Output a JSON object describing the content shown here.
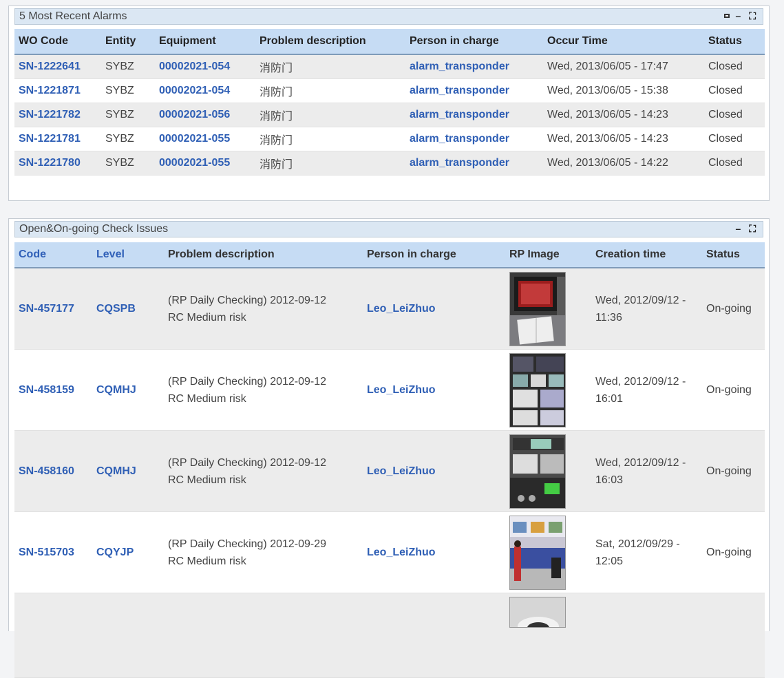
{
  "alarms": {
    "title": "5 Most Recent Alarms",
    "tools": [
      "settings-icon",
      "minimize-icon",
      "maximize-icon"
    ],
    "columns": [
      "WO Code",
      "Entity",
      "Equipment",
      "Problem description",
      "Person in charge",
      "Occur Time",
      "Status"
    ],
    "rows": [
      {
        "code": "SN-1222641",
        "entity": "SYBZ",
        "equipment": "00002021-054",
        "problem": "消防门",
        "person": "alarm_transponder",
        "time": "Wed, 2013/06/05 - 17:47",
        "status": "Closed"
      },
      {
        "code": "SN-1221871",
        "entity": "SYBZ",
        "equipment": "00002021-054",
        "problem": "消防门",
        "person": "alarm_transponder",
        "time": "Wed, 2013/06/05 - 15:38",
        "status": "Closed"
      },
      {
        "code": "SN-1221782",
        "entity": "SYBZ",
        "equipment": "00002021-056",
        "problem": "消防门",
        "person": "alarm_transponder",
        "time": "Wed, 2013/06/05 - 14:23",
        "status": "Closed"
      },
      {
        "code": "SN-1221781",
        "entity": "SYBZ",
        "equipment": "00002021-055",
        "problem": "消防门",
        "person": "alarm_transponder",
        "time": "Wed, 2013/06/05 - 14:23",
        "status": "Closed"
      },
      {
        "code": "SN-1221780",
        "entity": "SYBZ",
        "equipment": "00002021-055",
        "problem": "消防门",
        "person": "alarm_transponder",
        "time": "Wed, 2013/06/05 - 14:22",
        "status": "Closed"
      }
    ]
  },
  "issues": {
    "title": "Open&On-going Check Issues",
    "tools": [
      "minimize-icon",
      "maximize-icon"
    ],
    "columns": [
      "Code",
      "Level",
      "Problem description",
      "Person in charge",
      "RP Image",
      "Creation time",
      "Status"
    ],
    "rows": [
      {
        "code": "SN-457177",
        "level": "CQSPB",
        "problem_line1": "(RP Daily Checking) 2012-09-12",
        "problem_line2": "RC Medium risk",
        "person": "Leo_LeiZhuo",
        "image": "control-room-monitor-photo",
        "time_line1": "Wed, 2012/09/12 -",
        "time_line2": "11:36",
        "status": "On-going"
      },
      {
        "code": "SN-458159",
        "level": "CQMHJ",
        "problem_line1": "(RP Daily Checking) 2012-09-12",
        "problem_line2": "RC Medium risk",
        "person": "Leo_LeiZhuo",
        "image": "cctv-monitors-photo",
        "time_line1": "Wed, 2012/09/12 -",
        "time_line2": "16:01",
        "status": "On-going"
      },
      {
        "code": "SN-458160",
        "level": "CQMHJ",
        "problem_line1": "(RP Daily Checking) 2012-09-12",
        "problem_line2": "RC Medium risk",
        "person": "Leo_LeiZhuo",
        "image": "security-console-photo",
        "time_line1": "Wed, 2012/09/12 -",
        "time_line2": "16:03",
        "status": "On-going"
      },
      {
        "code": "SN-515703",
        "level": "CQYJP",
        "problem_line1": "(RP Daily Checking) 2012-09-29",
        "problem_line2": "RC Medium risk",
        "person": "Leo_LeiZhuo",
        "image": "store-counter-photo",
        "time_line1": "Sat, 2012/09/29 -",
        "time_line2": "12:05",
        "status": "On-going"
      }
    ],
    "partial_row_image": "ceiling-camera-photo"
  }
}
